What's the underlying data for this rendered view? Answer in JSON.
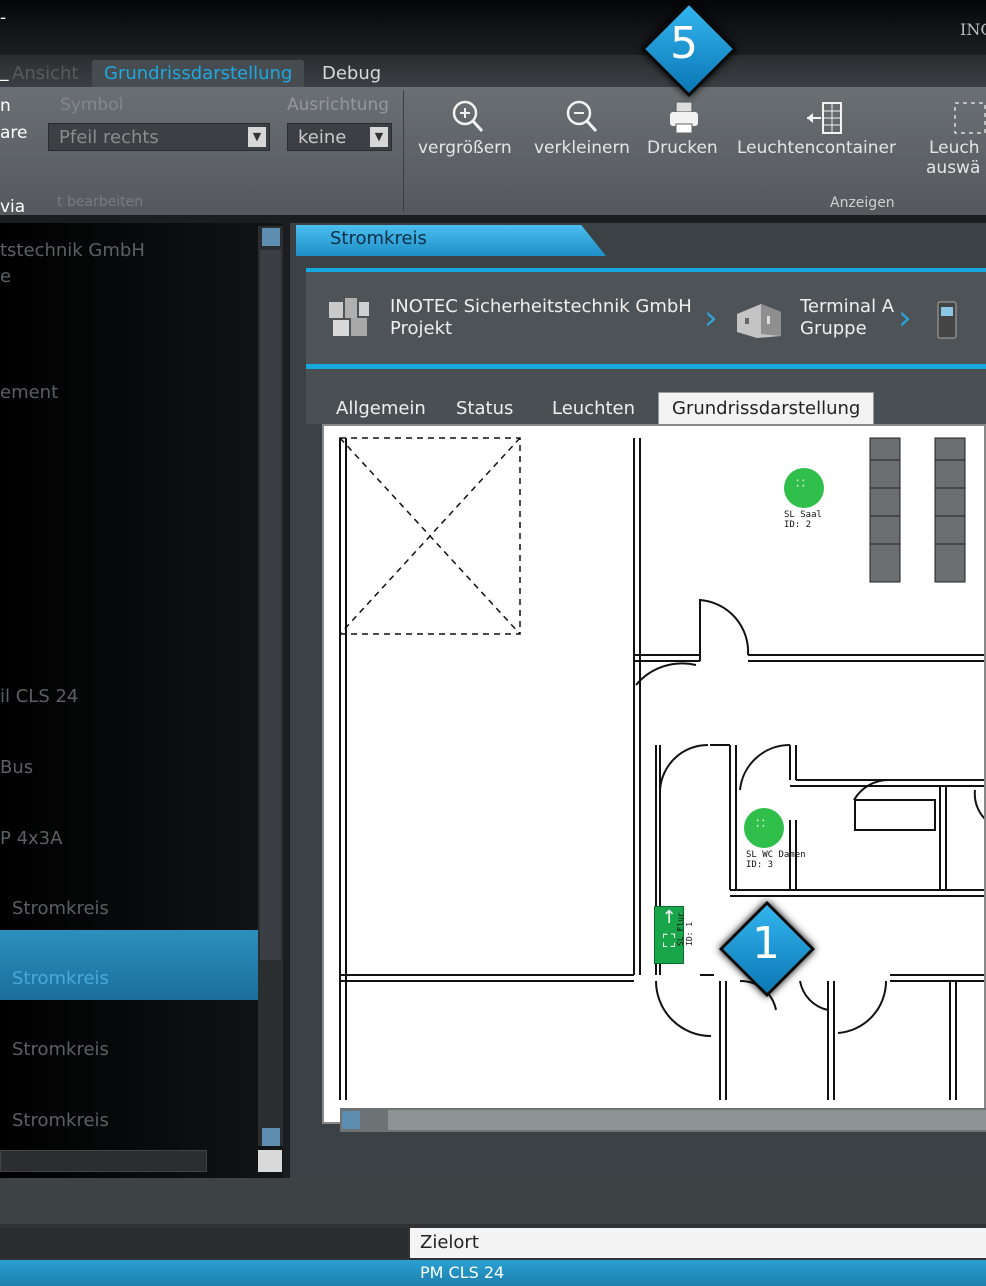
{
  "window": {
    "top_right_text": "INC"
  },
  "left_notes": [
    "-",
    "_",
    "n",
    "are",
    "via"
  ],
  "ribbon": {
    "tabs": [
      "Ansicht",
      "Grundrissdarstellung",
      "Debug"
    ],
    "active_tab": "Grundrissdarstellung",
    "symbol_label": "Symbol",
    "symbol_value": "Pfeil rechts",
    "ausrichtung_label": "Ausrichtung",
    "ausrichtung_value": "keine",
    "edit_group_label": "t bearbeiten",
    "buttons": [
      {
        "label": "vergrößern",
        "icon": "zoom-in-icon"
      },
      {
        "label": "verkleinern",
        "icon": "zoom-out-icon"
      },
      {
        "label": "Drucken",
        "icon": "printer-icon"
      },
      {
        "label": "Leuchtencontainer",
        "icon": "container-icon"
      },
      {
        "label": "Leuch",
        "label2": "auswä",
        "icon": "select-icon"
      }
    ],
    "anzeigen_group_label": "Anzeigen"
  },
  "tree": {
    "items": [
      "tstechnik GmbH",
      "e",
      "ement",
      "il CLS 24",
      "Bus",
      "P 4x3A",
      "Stromkreis",
      "Stromkreis",
      "Stromkreis",
      "Stromkreis"
    ],
    "selected_index": 7
  },
  "panel": {
    "tab_title": "Stromkreis",
    "breadcrumb": [
      {
        "title": "INOTEC Sicherheitstechnik GmbH",
        "subtitle": "Projekt",
        "icon": "project-icon"
      },
      {
        "title": "Terminal A",
        "subtitle": "Gruppe",
        "icon": "building-icon"
      },
      {
        "title": "",
        "subtitle": "",
        "icon": "device-icon"
      }
    ],
    "subtabs": [
      "Allgemein",
      "Status",
      "Leuchten",
      "Grundrissdarstellung"
    ],
    "active_subtab": "Grundrissdarstellung"
  },
  "floorplan": {
    "lights": [
      {
        "name": "SL Saal",
        "id": "ID: 2",
        "color": "#2fbf4a"
      },
      {
        "name": "SL WC Damen",
        "id": "ID: 3",
        "color": "#2fbf4a"
      }
    ],
    "exit_sign": {
      "label": "SL Flur",
      "id": "ID: 1",
      "color": "#19a64a"
    }
  },
  "bottom": {
    "column_header": "Zielort",
    "selected_row": "PM CLS 24"
  },
  "callouts": [
    {
      "number": "5"
    },
    {
      "number": "1"
    }
  ],
  "colors": {
    "accent": "#1fa8e0",
    "selection": "#2b8fbe"
  }
}
